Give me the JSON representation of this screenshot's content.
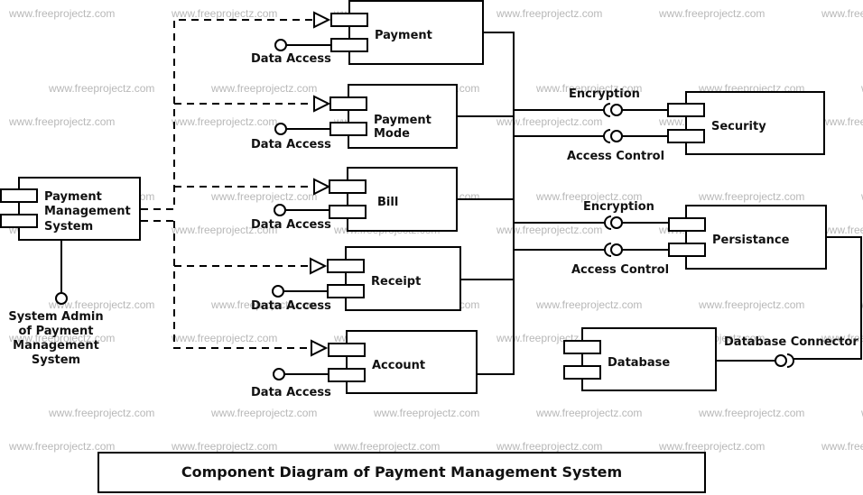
{
  "watermark": "www.freeprojectz.com",
  "title": "Component Diagram of Payment Management System",
  "components": {
    "pms": [
      "Payment",
      "Management",
      "System"
    ],
    "payment": [
      "Payment"
    ],
    "payment_mode": [
      "Payment",
      "Mode"
    ],
    "bill": [
      "Bill"
    ],
    "receipt": [
      "Receipt"
    ],
    "account": [
      "Account"
    ],
    "security": [
      "Security"
    ],
    "persistance": [
      "Persistance"
    ],
    "database": [
      "Database"
    ]
  },
  "interfaces": {
    "data_access": "Data Access",
    "encryption": "Encryption",
    "access_control": "Access Control",
    "database_connector": "Database Connector",
    "system_admin": [
      "System Admin",
      "of Payment",
      "Management",
      "System"
    ]
  }
}
